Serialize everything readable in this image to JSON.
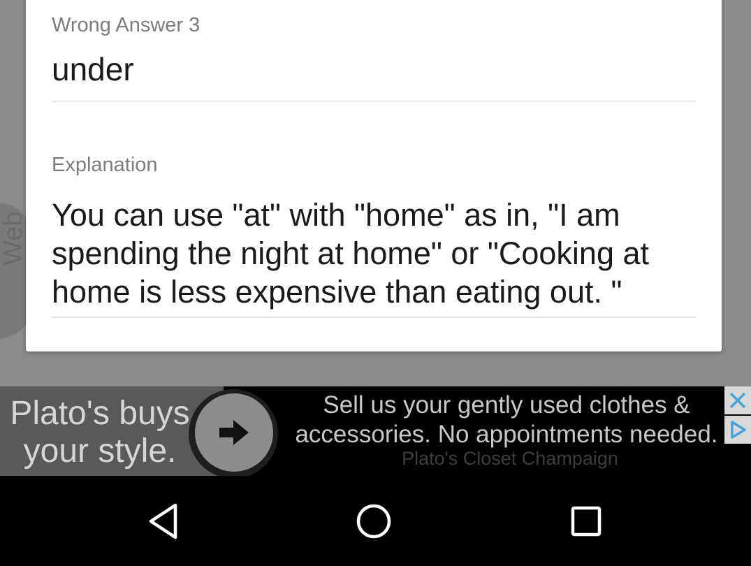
{
  "background": {
    "side_tab_label": "Web"
  },
  "dialog": {
    "wrong_answer_3": {
      "label": "Wrong Answer 3",
      "value": "under"
    },
    "explanation": {
      "label": "Explanation",
      "value": "You can use \"at\" with \"home\" as in, \"I am spending the night at home\" or \"Cooking at home is less expensive than eating out. \""
    }
  },
  "ad": {
    "headline": "Plato's buys your style.",
    "body": "Sell us your gently used clothes & accessories. No appointments needed.",
    "advertiser": "Plato's Closet Champaign",
    "icons": {
      "arrow": "arrow-right-icon",
      "close": "close-icon",
      "choices": "ad-choices-icon"
    },
    "accent_color": "#4aa3d8"
  },
  "navbar": {
    "icons": [
      "back-triangle-icon",
      "home-circle-icon",
      "recents-square-icon"
    ]
  }
}
